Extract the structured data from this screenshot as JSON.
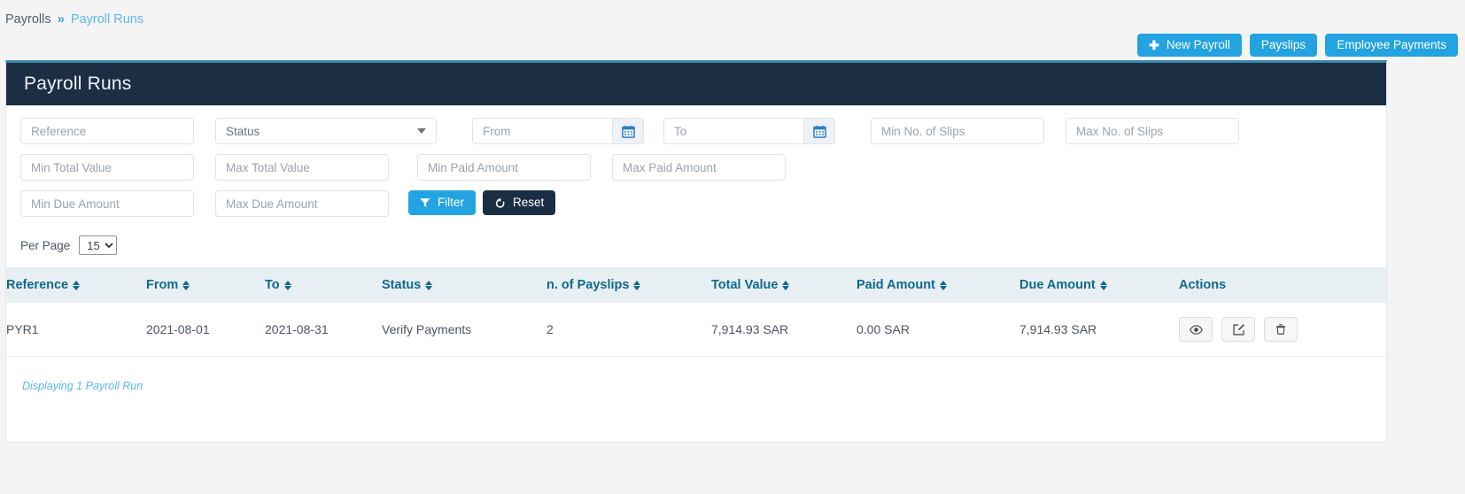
{
  "breadcrumb": {
    "root": "Payrolls",
    "separator": "»",
    "current": "Payroll Runs"
  },
  "topbar": {
    "new_payroll": "New Payroll",
    "new_payroll_icon": "plus-icon",
    "payslips": "Payslips",
    "employee_payments": "Employee Payments"
  },
  "panel": {
    "title": "Payroll Runs"
  },
  "filters": {
    "reference_placeholder": "Reference",
    "status_label": "Status",
    "from_placeholder": "From",
    "to_placeholder": "To",
    "min_slips_placeholder": "Min No. of Slips",
    "max_slips_placeholder": "Max No. of Slips",
    "min_total_placeholder": "Min Total Value",
    "max_total_placeholder": "Max Total Value",
    "min_paid_placeholder": "Min Paid Amount",
    "max_paid_placeholder": "Max Paid Amount",
    "min_due_placeholder": "Min Due Amount",
    "max_due_placeholder": "Max Due Amount",
    "filter_button": "Filter",
    "reset_button": "Reset",
    "calendar_icon": "calendar-icon",
    "filter_icon": "funnel-icon",
    "reset_icon": "undo-icon"
  },
  "pagination": {
    "per_page_label": "Per Page",
    "per_page_value": "15",
    "per_page_options": [
      "15"
    ]
  },
  "table": {
    "columns": [
      {
        "label": "Reference",
        "sortable": true
      },
      {
        "label": "From",
        "sortable": true
      },
      {
        "label": "To",
        "sortable": true
      },
      {
        "label": "Status",
        "sortable": true
      },
      {
        "label": "n. of Payslips",
        "sortable": true
      },
      {
        "label": "Total Value",
        "sortable": true
      },
      {
        "label": "Paid Amount",
        "sortable": true
      },
      {
        "label": "Due Amount",
        "sortable": true
      },
      {
        "label": "Actions",
        "sortable": false
      }
    ],
    "rows": [
      {
        "reference": "PYR1",
        "from": "2021-08-01",
        "to": "2021-08-31",
        "status": "Verify Payments",
        "payslips": "2",
        "total_value": "7,914.93 SAR",
        "paid_amount": "0.00 SAR",
        "due_amount": "7,914.93 SAR",
        "actions": [
          "eye-icon",
          "edit-icon",
          "trash-icon"
        ]
      }
    ],
    "footer_note": "Displaying 1 Payroll Run"
  },
  "colors": {
    "accent_blue": "#23a3e0",
    "header_navy": "#1c2e44",
    "header_top_border": "#3b87aa",
    "table_head_bg": "#e8eff2",
    "table_head_text": "#11688f",
    "link_blue": "#5bb7ea"
  }
}
